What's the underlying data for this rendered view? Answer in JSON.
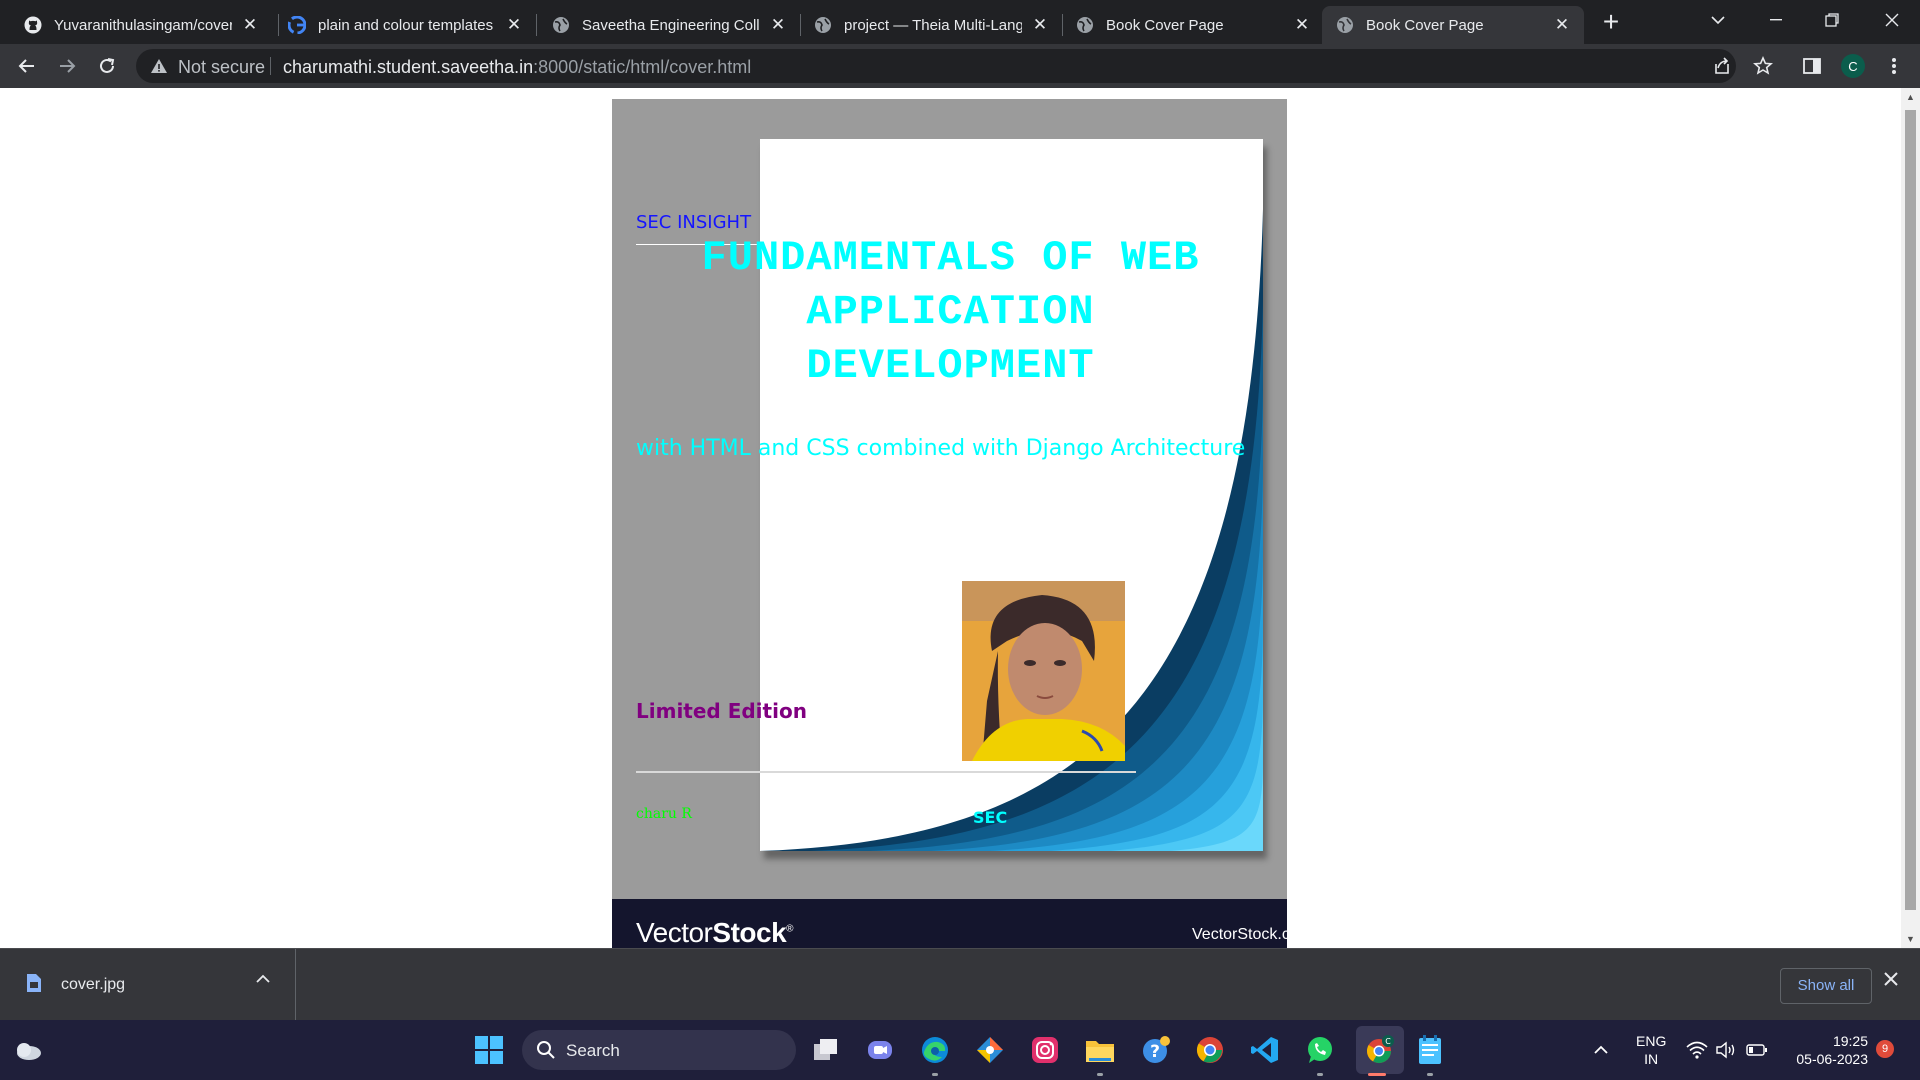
{
  "colors": {
    "tab_strip": "#202124",
    "toolbar": "#35363a",
    "cover_bg": "#9b9b9b",
    "title": "#00ffff",
    "brand": "#1515ff",
    "edition": "#800080",
    "author": "#00ff00",
    "taskbar": "#1f1f3a"
  },
  "tabs": [
    {
      "title": "Yuvaranithulasingam/cover",
      "icon": "github-icon"
    },
    {
      "title": "plain and colour templates",
      "icon": "google-icon"
    },
    {
      "title": "Saveetha Engineering Colle",
      "icon": "globe-icon"
    },
    {
      "title": "project — Theia Multi-Lang",
      "icon": "globe-icon"
    },
    {
      "title": "Book Cover Page",
      "icon": "globe-icon"
    },
    {
      "title": "Book Cover Page",
      "icon": "globe-icon",
      "active": true
    }
  ],
  "address_bar": {
    "security_label": "Not secure",
    "url_host": "charumathi.student.saveetha.in",
    "url_path": ":8000/static/html/cover.html"
  },
  "profile_initial": "C",
  "cover": {
    "brand": "SEC INSIGHT",
    "title_lines": [
      "FUNDAMENTALS OF WEB",
      "APPLICATION",
      "DEVELOPMENT"
    ],
    "subtitle": "with HTML and CSS combined with Django Architecture",
    "edition": "Limited Edition",
    "author": "charu R",
    "publisher": "SEC",
    "stock_logo_light": "Vector",
    "stock_logo_bold": "Stock",
    "stock_logo_mark": "®",
    "stock_site": "VectorStock.c"
  },
  "downloads": {
    "file_name": "cover.jpg",
    "show_all": "Show all"
  },
  "taskbar": {
    "search_placeholder": "Search",
    "lang_1": "ENG",
    "lang_2": "IN",
    "time": "19:25",
    "date": "05-06-2023",
    "notification_count": "9",
    "chrome_badge": "C"
  }
}
